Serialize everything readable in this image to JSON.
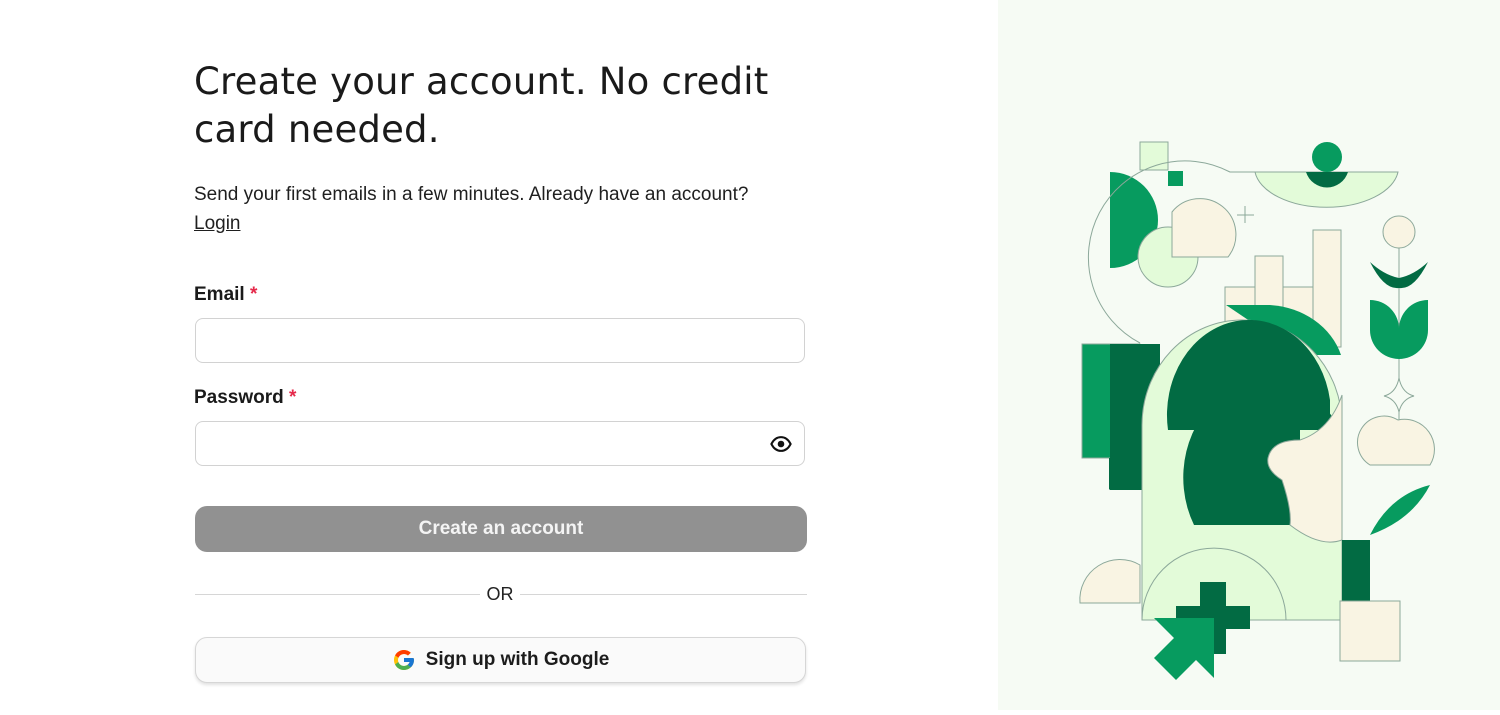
{
  "header": {
    "title": "Create your account. No credit card needed.",
    "subtitle": "Send your first emails in a few minutes. Already have an account?",
    "login_link": "Login"
  },
  "form": {
    "email": {
      "label": "Email",
      "required_mark": "*",
      "value": "",
      "placeholder": ""
    },
    "password": {
      "label": "Password",
      "required_mark": "*",
      "value": "",
      "placeholder": "",
      "toggle_icon": "eye-icon"
    },
    "submit_label": "Create an account",
    "divider_text": "OR",
    "google_label": "Sign up with Google",
    "google_icon": "google-logo-icon"
  },
  "colors": {
    "accent_dark_green": "#026b43",
    "accent_green": "#079b5f",
    "light_green": "#e3fbd9",
    "cream": "#f9f4e3",
    "required_red": "#e5294a",
    "disabled_button": "#919191"
  }
}
